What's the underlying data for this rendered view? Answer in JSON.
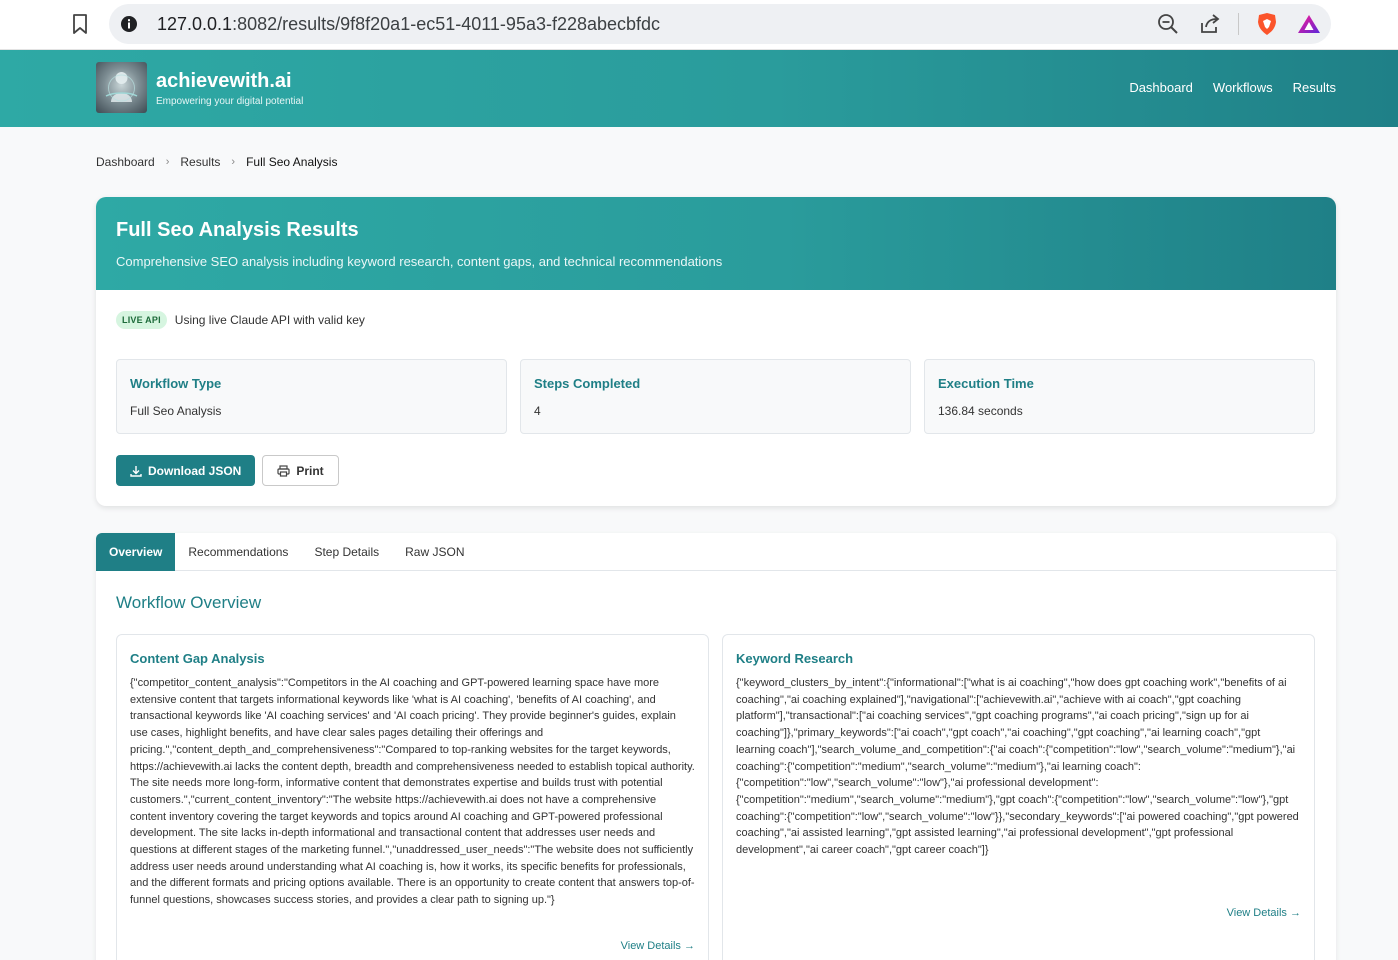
{
  "browser": {
    "url_host": "127.0.0.1",
    "url_rest": ":8082/results/9f8f20a1-ec51-4011-95a3-f228abecbfdc"
  },
  "header": {
    "brand": "achievewith.ai",
    "tagline": "Empowering your digital potential",
    "nav": [
      "Dashboard",
      "Workflows",
      "Results"
    ]
  },
  "breadcrumb": [
    "Dashboard",
    "Results",
    "Full Seo Analysis"
  ],
  "results": {
    "title": "Full Seo Analysis Results",
    "subtitle": "Comprehensive SEO analysis including keyword research, content gaps, and technical recommendations",
    "api_badge": "LIVE API",
    "api_text": "Using live Claude API with valid key",
    "stats": [
      {
        "label": "Workflow Type",
        "value": "Full Seo Analysis"
      },
      {
        "label": "Steps Completed",
        "value": "4"
      },
      {
        "label": "Execution Time",
        "value": "136.84 seconds"
      }
    ],
    "download_label": "Download JSON",
    "print_label": "Print"
  },
  "tabs": [
    "Overview",
    "Recommendations",
    "Step Details",
    "Raw JSON"
  ],
  "overview": {
    "title": "Workflow Overview",
    "cards": [
      {
        "title": "Content Gap Analysis",
        "body": "{\"competitor_content_analysis\":\"Competitors in the AI coaching and GPT-powered learning space have more extensive content that targets informational keywords like 'what is AI coaching', 'benefits of AI coaching', and transactional keywords like 'AI coaching services' and 'AI coach pricing'. They provide beginner's guides, explain use cases, highlight benefits, and have clear sales pages detailing their offerings and pricing.\",\"content_depth_and_comprehensiveness\":\"Compared to top-ranking websites for the target keywords, https://achievewith.ai lacks the content depth, breadth and comprehensiveness needed to establish topical authority. The site needs more long-form, informative content that demonstrates expertise and builds trust with potential customers.\",\"current_content_inventory\":\"The website https://achievewith.ai does not have a comprehensive content inventory covering the target keywords and topics around AI coaching and GPT-powered professional development. The site lacks in-depth informational and transactional content that addresses user needs and questions at different stages of the marketing funnel.\",\"unaddressed_user_needs\":\"The website does not sufficiently address user needs around understanding what AI coaching is, how it works, its specific benefits for professionals, and the different formats and pricing options available. There is an opportunity to create content that answers top-of-funnel questions, showcases success stories, and provides a clear path to signing up.\"}",
        "link": "View Details →"
      },
      {
        "title": "Keyword Research",
        "body": "{\"keyword_clusters_by_intent\":{\"informational\":[\"what is ai coaching\",\"how does gpt coaching work\",\"benefits of ai coaching\",\"ai coaching explained\"],\"navigational\":[\"achievewith.ai\",\"achieve with ai coach\",\"gpt coaching platform\"],\"transactional\":[\"ai coaching services\",\"gpt coaching programs\",\"ai coach pricing\",\"sign up for ai coaching\"]},\"primary_keywords\":[\"ai coach\",\"gpt coach\",\"ai coaching\",\"gpt coaching\",\"ai learning coach\",\"gpt learning coach\"],\"search_volume_and_competition\":{\"ai coach\":{\"competition\":\"low\",\"search_volume\":\"medium\"},\"ai coaching\":{\"competition\":\"medium\",\"search_volume\":\"medium\"},\"ai learning coach\":{\"competition\":\"low\",\"search_volume\":\"low\"},\"ai professional development\":{\"competition\":\"medium\",\"search_volume\":\"medium\"},\"gpt coach\":{\"competition\":\"low\",\"search_volume\":\"low\"},\"gpt coaching\":{\"competition\":\"low\",\"search_volume\":\"low\"}},\"secondary_keywords\":[\"ai powered coaching\",\"gpt powered coaching\",\"ai assisted learning\",\"gpt assisted learning\",\"ai professional development\",\"gpt professional development\",\"ai career coach\",\"gpt career coach\"]}",
        "link": "View Details →"
      }
    ]
  },
  "colors": {
    "teal_light": "#2ea9a5",
    "teal_dark": "#1f7f86",
    "badge_bg": "#d6f5e0",
    "badge_text": "#1d6b3a"
  }
}
